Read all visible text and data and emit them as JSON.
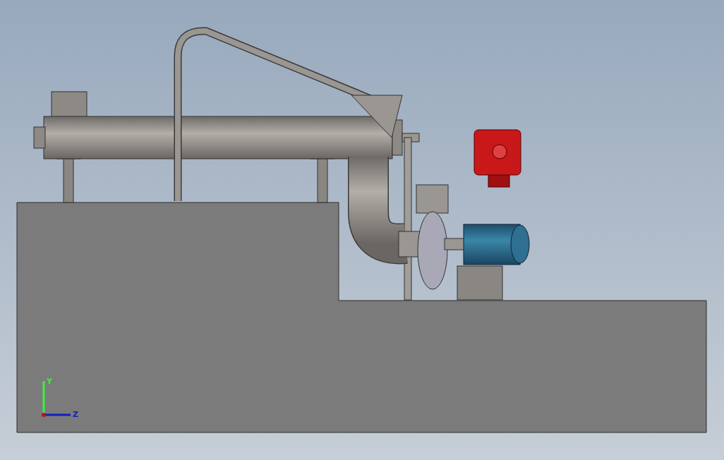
{
  "viewport": {
    "triad": {
      "axes": [
        {
          "label": "Y",
          "color": "#3cf03c"
        },
        {
          "label": "Z",
          "color": "#1020c0"
        }
      ]
    }
  }
}
